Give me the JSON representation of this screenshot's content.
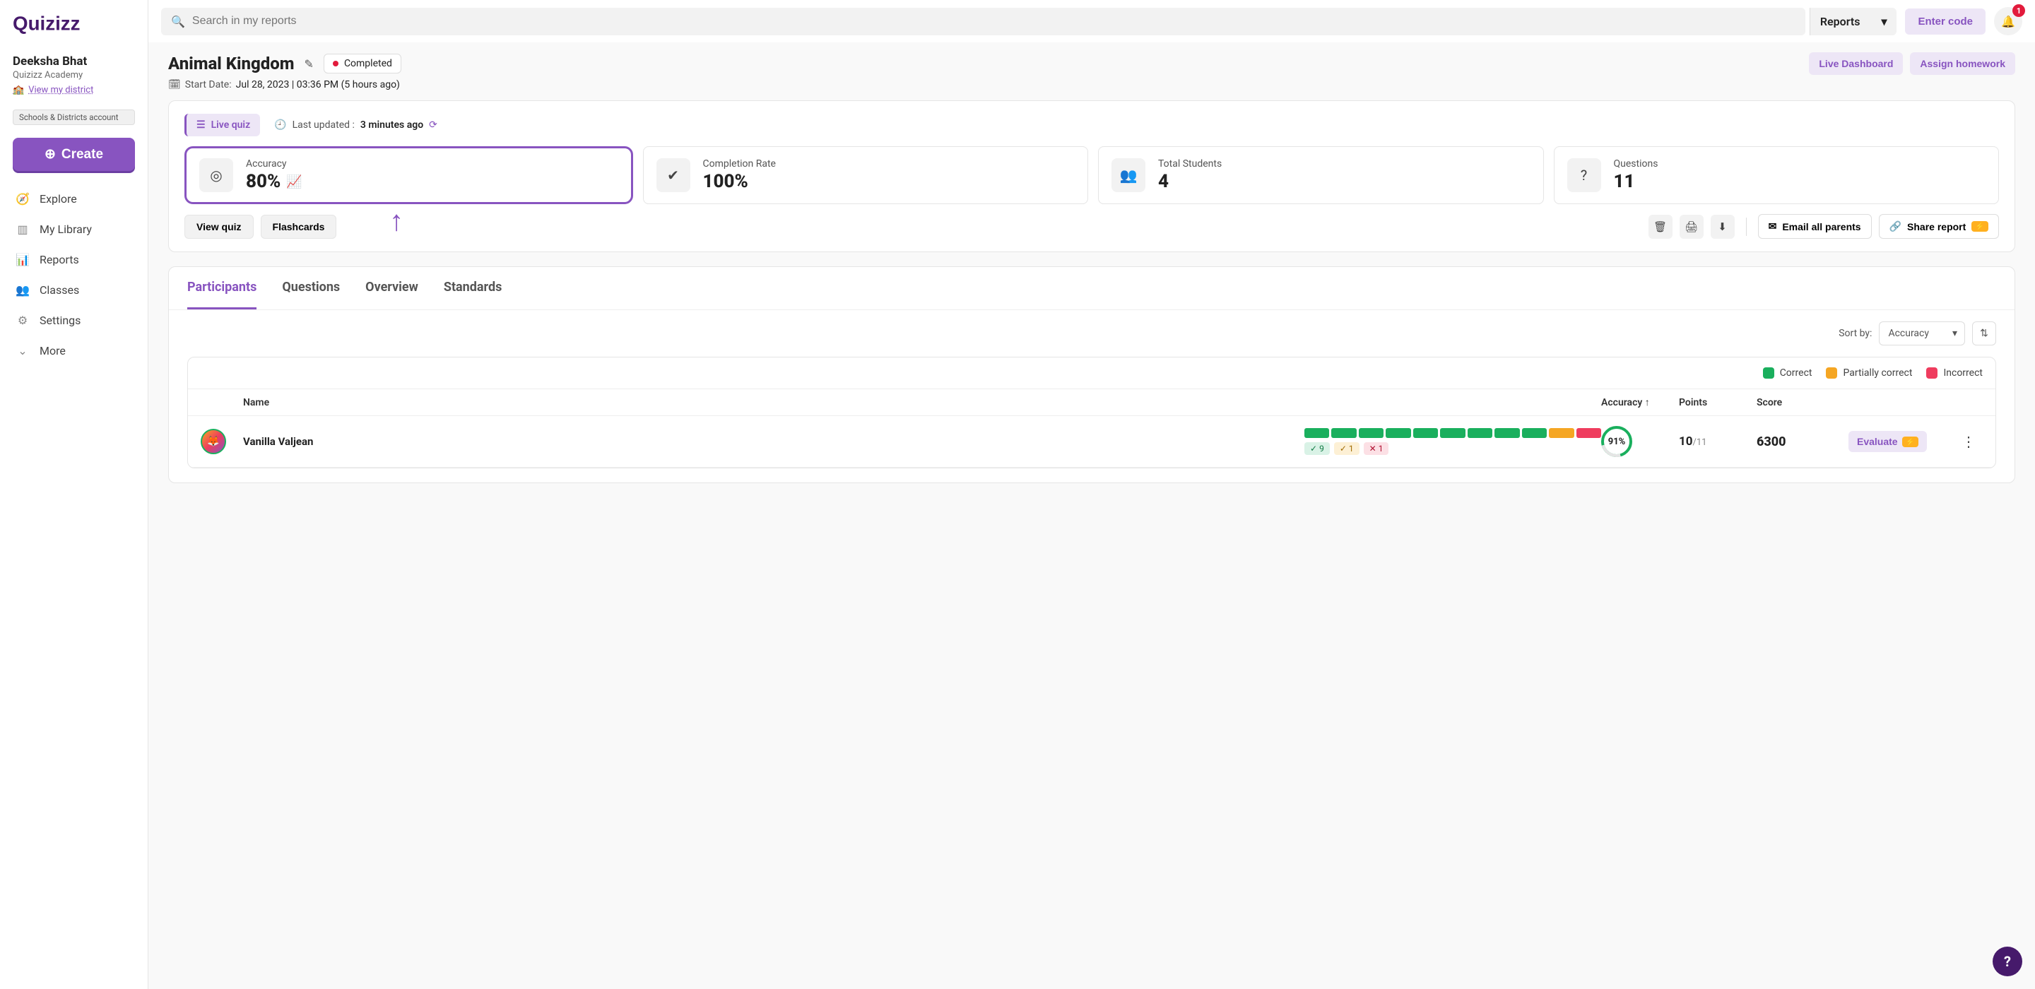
{
  "sidebar": {
    "user_name": "Deeksha Bhat",
    "user_org": "Quizizz Academy",
    "district_link": "View my district",
    "account_badge": "Schools & Districts account",
    "create_label": "Create",
    "nav": [
      {
        "label": "Explore",
        "icon": "🧭"
      },
      {
        "label": "My Library",
        "icon": "▥"
      },
      {
        "label": "Reports",
        "icon": "📊"
      },
      {
        "label": "Classes",
        "icon": "👥"
      },
      {
        "label": "Settings",
        "icon": "⚙"
      },
      {
        "label": "More",
        "icon": "⌄"
      }
    ]
  },
  "topbar": {
    "search_placeholder": "Search in my reports",
    "filter_label": "Reports",
    "enter_code": "Enter code",
    "bell_count": "1"
  },
  "header": {
    "title": "Animal Kingdom",
    "status": "Completed",
    "live_dashboard": "Live Dashboard",
    "assign_homework": "Assign homework",
    "start_date_label": "Start Date:",
    "start_date_value": "Jul 28, 2023 | 03:36 PM (5 hours ago)"
  },
  "summary": {
    "live_quiz_label": "Live quiz",
    "updated_prefix": "Last updated :",
    "updated_value": "3 minutes ago",
    "stats": {
      "accuracy": {
        "label": "Accuracy",
        "value": "80%"
      },
      "completion": {
        "label": "Completion Rate",
        "value": "100%"
      },
      "students": {
        "label": "Total Students",
        "value": "4"
      },
      "questions": {
        "label": "Questions",
        "value": "11"
      }
    },
    "view_quiz": "View quiz",
    "flashcards": "Flashcards",
    "email_parents": "Email all parents",
    "share_report": "Share report"
  },
  "tabs": {
    "participants": "Participants",
    "questions": "Questions",
    "overview": "Overview",
    "standards": "Standards"
  },
  "sort": {
    "label": "Sort by:",
    "value": "Accuracy"
  },
  "legend": {
    "correct": "Correct",
    "partial": "Partially correct",
    "incorrect": "Incorrect"
  },
  "columns": {
    "name": "Name",
    "accuracy": "Accuracy ↑",
    "points": "Points",
    "score": "Score"
  },
  "participants": [
    {
      "name": "Vanilla Valjean",
      "correct_n": "9",
      "partial_n": "1",
      "incorrect_n": "1",
      "accuracy": "91%",
      "points_got": "10",
      "points_total": "/11",
      "score": "6300",
      "evaluate": "Evaluate"
    }
  ]
}
